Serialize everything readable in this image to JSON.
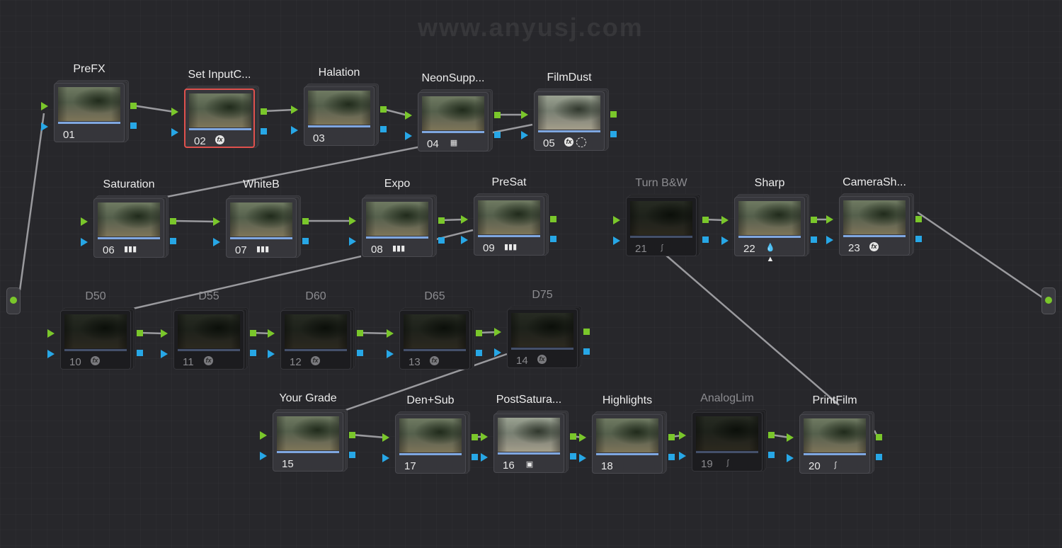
{
  "watermark": "www.anyusj.com",
  "colors": {
    "background": "#27272b",
    "rgb_pin": "#7ac72b",
    "alpha_pin": "#27a7e6",
    "selected_border": "#e0514d",
    "wire": "#9a9a9e"
  },
  "nodes": [
    {
      "id": "01",
      "label": "PreFX",
      "icons": [],
      "state": "normal"
    },
    {
      "id": "02",
      "label": "Set InputC...",
      "icons": [
        "fx-icon"
      ],
      "state": "selected"
    },
    {
      "id": "03",
      "label": "Halation",
      "icons": [],
      "state": "normal"
    },
    {
      "id": "04",
      "label": "NeonSupp...",
      "icons": [
        "grid-icon"
      ],
      "state": "normal"
    },
    {
      "id": "05",
      "label": "FilmDust",
      "icons": [
        "fx-icon",
        "window-circle-icon"
      ],
      "state": "normal"
    },
    {
      "id": "06",
      "label": "Saturation",
      "icons": [
        "bars-icon"
      ],
      "state": "normal"
    },
    {
      "id": "07",
      "label": "WhiteB",
      "icons": [
        "bars-icon"
      ],
      "state": "normal"
    },
    {
      "id": "08",
      "label": "Expo",
      "icons": [
        "bars-icon"
      ],
      "state": "normal"
    },
    {
      "id": "09",
      "label": "PreSat",
      "icons": [
        "bars-icon"
      ],
      "state": "normal"
    },
    {
      "id": "21",
      "label": "Turn B&W",
      "icons": [
        "curve-icon"
      ],
      "state": "disabled"
    },
    {
      "id": "22",
      "label": "Sharp",
      "icons": [
        "blur-sharpen-icon"
      ],
      "state": "normal"
    },
    {
      "id": "23",
      "label": "CameraSh...",
      "icons": [
        "fx-icon"
      ],
      "state": "normal"
    },
    {
      "id": "10",
      "label": "D50",
      "icons": [
        "fx-icon"
      ],
      "state": "disabled"
    },
    {
      "id": "11",
      "label": "D55",
      "icons": [
        "fx-icon"
      ],
      "state": "disabled"
    },
    {
      "id": "12",
      "label": "D60",
      "icons": [
        "fx-icon"
      ],
      "state": "disabled"
    },
    {
      "id": "13",
      "label": "D65",
      "icons": [
        "fx-icon"
      ],
      "state": "disabled"
    },
    {
      "id": "14",
      "label": "D75",
      "icons": [
        "fx-icon"
      ],
      "state": "disabled"
    },
    {
      "id": "15",
      "label": "Your Grade",
      "icons": [],
      "state": "normal"
    },
    {
      "id": "17",
      "label": "Den+Sub",
      "icons": [],
      "state": "normal"
    },
    {
      "id": "16",
      "label": "PostSatura...",
      "icons": [
        "lut-icon"
      ],
      "state": "normal"
    },
    {
      "id": "18",
      "label": "Highlights",
      "icons": [],
      "state": "normal"
    },
    {
      "id": "19",
      "label": "AnalogLim",
      "icons": [
        "curve-icon"
      ],
      "state": "disabled"
    },
    {
      "id": "20",
      "label": "PrintFilm",
      "icons": [
        "curve-icon"
      ],
      "state": "normal"
    }
  ]
}
